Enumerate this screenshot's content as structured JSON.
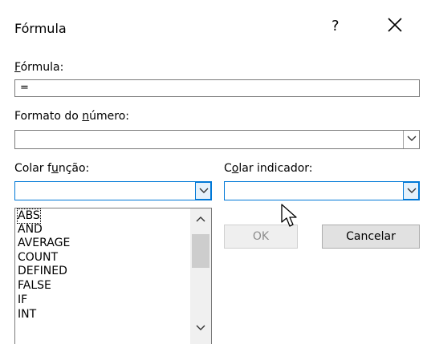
{
  "dialog": {
    "title": "Fórmula",
    "help": "?",
    "formula_label_accel": "F",
    "formula_label_rest": "órmula:",
    "formula_value": "=",
    "number_format_label_pre": "Formato do ",
    "number_format_label_accel": "n",
    "number_format_label_post": "úmero:",
    "number_format_value": "",
    "paste_function_label_pre": "Colar f",
    "paste_function_label_accel": "u",
    "paste_function_label_post": "nção:",
    "paste_function_value": "",
    "paste_bookmark_label_pre": "C",
    "paste_bookmark_label_accel": "o",
    "paste_bookmark_label_post": "lar indicador:",
    "paste_bookmark_value": "",
    "ok_label": "OK",
    "cancel_label": "Cancelar"
  },
  "function_list": [
    "ABS",
    "AND",
    "AVERAGE",
    "COUNT",
    "DEFINED",
    "FALSE",
    "IF",
    "INT"
  ],
  "icons": {
    "close": "close-icon",
    "chevron": "chevron-down-icon",
    "scroll_up": "scroll-up-icon",
    "scroll_down": "scroll-down-icon",
    "cursor": "mouse-pointer-icon"
  },
  "colors": {
    "focus_border": "#0078d7",
    "button_face": "#e1e1e1",
    "disabled_text": "#8c8c8c"
  }
}
